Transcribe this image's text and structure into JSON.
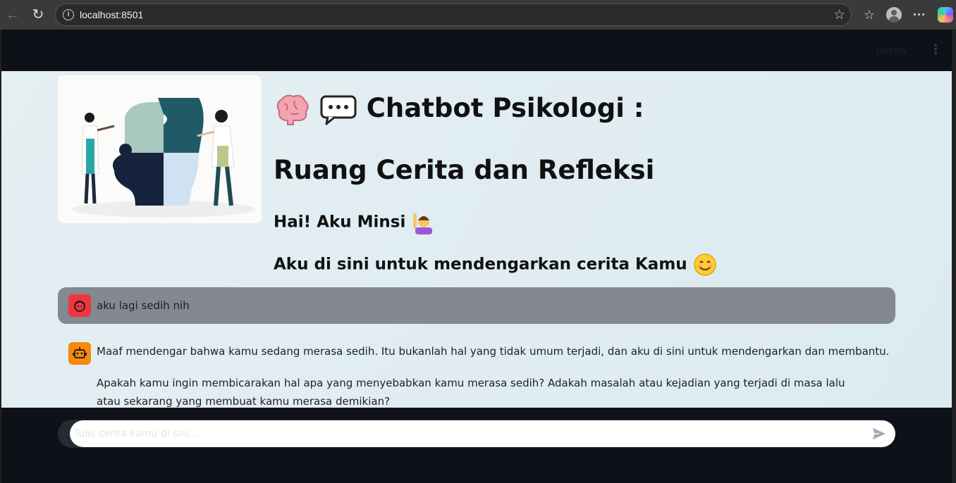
{
  "browser": {
    "address": "localhost:8501"
  },
  "app_header": {
    "deploy_label": "Deploy"
  },
  "hero": {
    "title_line1": "Chatbot Psikologi :",
    "title_line2": "Ruang Cerita dan Refleksi",
    "subtitle_line1": "Hai! Aku Minsi",
    "subtitle_line2": "Aku di sini untuk mendengarkan cerita Kamu"
  },
  "chat": {
    "messages": [
      {
        "role": "user",
        "text": "aku lagi sedih nih"
      },
      {
        "role": "assistant",
        "paragraphs": [
          "Maaf mendengar bahwa kamu sedang merasa sedih. Itu bukanlah hal yang tidak umum terjadi, dan aku di sini untuk mendengarkan dan membantu.",
          "Apakah kamu ingin membicarakan hal apa yang menyebabkan kamu merasa sedih? Adakah masalah atau kejadian yang terjadi di masa lalu atau sekarang yang membuat kamu merasa demikian?"
        ]
      }
    ],
    "input": {
      "value": "",
      "placeholder": "Tulis cerita kamu di sini..."
    }
  },
  "colors": {
    "header_bg": "#0e1117",
    "user_bubble": "#838891",
    "user_avatar": "#f0353f",
    "bot_avatar": "#f6890b",
    "page_bg": "#e0edf2"
  },
  "icons": {
    "brain": "brain-emoji",
    "speech": "speech-bubble-emoji",
    "wave": "raising-hand-emoji",
    "smile": "smiling-face-emoji"
  }
}
